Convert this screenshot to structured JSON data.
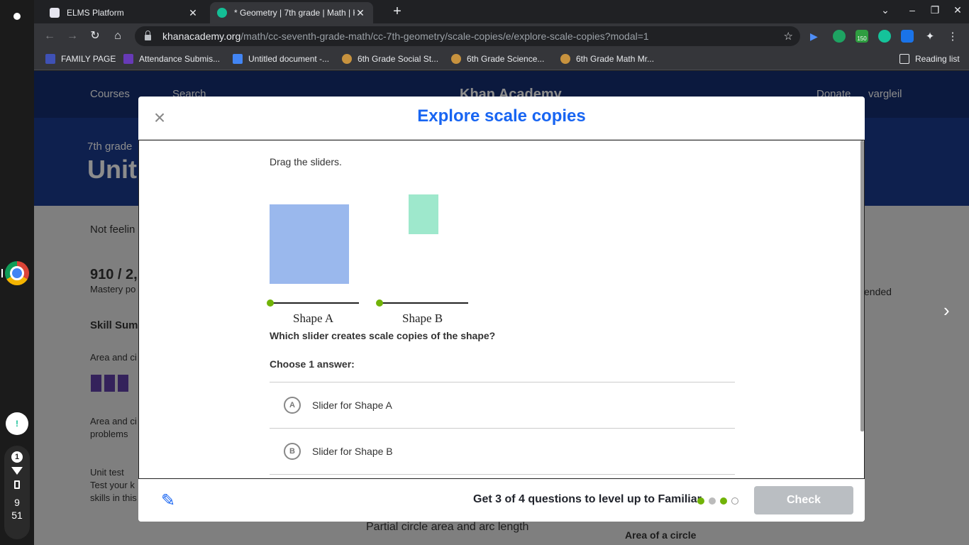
{
  "tabs": [
    {
      "title": "ELMS Platform",
      "active": false
    },
    {
      "title": "* Geometry | 7th grade | Math | K",
      "active": true
    }
  ],
  "address": {
    "domain": "khanacademy.org",
    "path": "/math/cc-seventh-grade-math/cc-7th-geometry/scale-copies/e/explore-scale-copies?modal=1"
  },
  "bookmarks": [
    "FAMILY PAGE",
    "Attendance Submis...",
    "Untitled document -...",
    "6th Grade Social St...",
    "6th Grade Science...",
    "6th Grade Math Mr..."
  ],
  "reading_list": "Reading list",
  "extension_badge": "150",
  "tray": {
    "notifications": "1",
    "hour": "9",
    "minute": "51"
  },
  "background_page": {
    "courses": "Courses",
    "search_placeholder": "Search",
    "logo": "Khan Academy",
    "donate": "Donate",
    "user": "vargleil",
    "grade": "7th grade",
    "unit": "Unit",
    "not_feeling": "Not feelin",
    "points": "910 / 2,",
    "mastery": "Mastery po",
    "skill_summary": "Skill Summ",
    "area_1": "Area and ci",
    "area_2": "Area and ci",
    "problems": "problems",
    "unit_test": "Unit test",
    "test_your": "Test your k",
    "skills_in": "skills in this",
    "recommended": "ended",
    "partial": "Partial circle area and arc length",
    "area_circle": "Area of a circle"
  },
  "modal": {
    "title": "Explore scale copies",
    "prompt": "Drag the sliders.",
    "shape_a_label": "Shape A",
    "shape_b_label": "Shape B",
    "question": "Which slider creates scale copies of the shape?",
    "choose": "Choose 1 answer:",
    "choices": [
      {
        "letter": "A",
        "text": "Slider for Shape A"
      },
      {
        "letter": "B",
        "text": "Slider for Shape B"
      }
    ],
    "level_text": "Get 3 of 4 questions to level up to Familiar",
    "progress_dots": [
      "#71b307",
      "#bbbbbb",
      "#71b307",
      "empty"
    ],
    "check_label": "Check"
  },
  "colors": {
    "accent": "#1865f2",
    "shape_a": "#9ab8ed",
    "shape_b": "#9ee8cc",
    "slider_handle": "#71b307"
  }
}
